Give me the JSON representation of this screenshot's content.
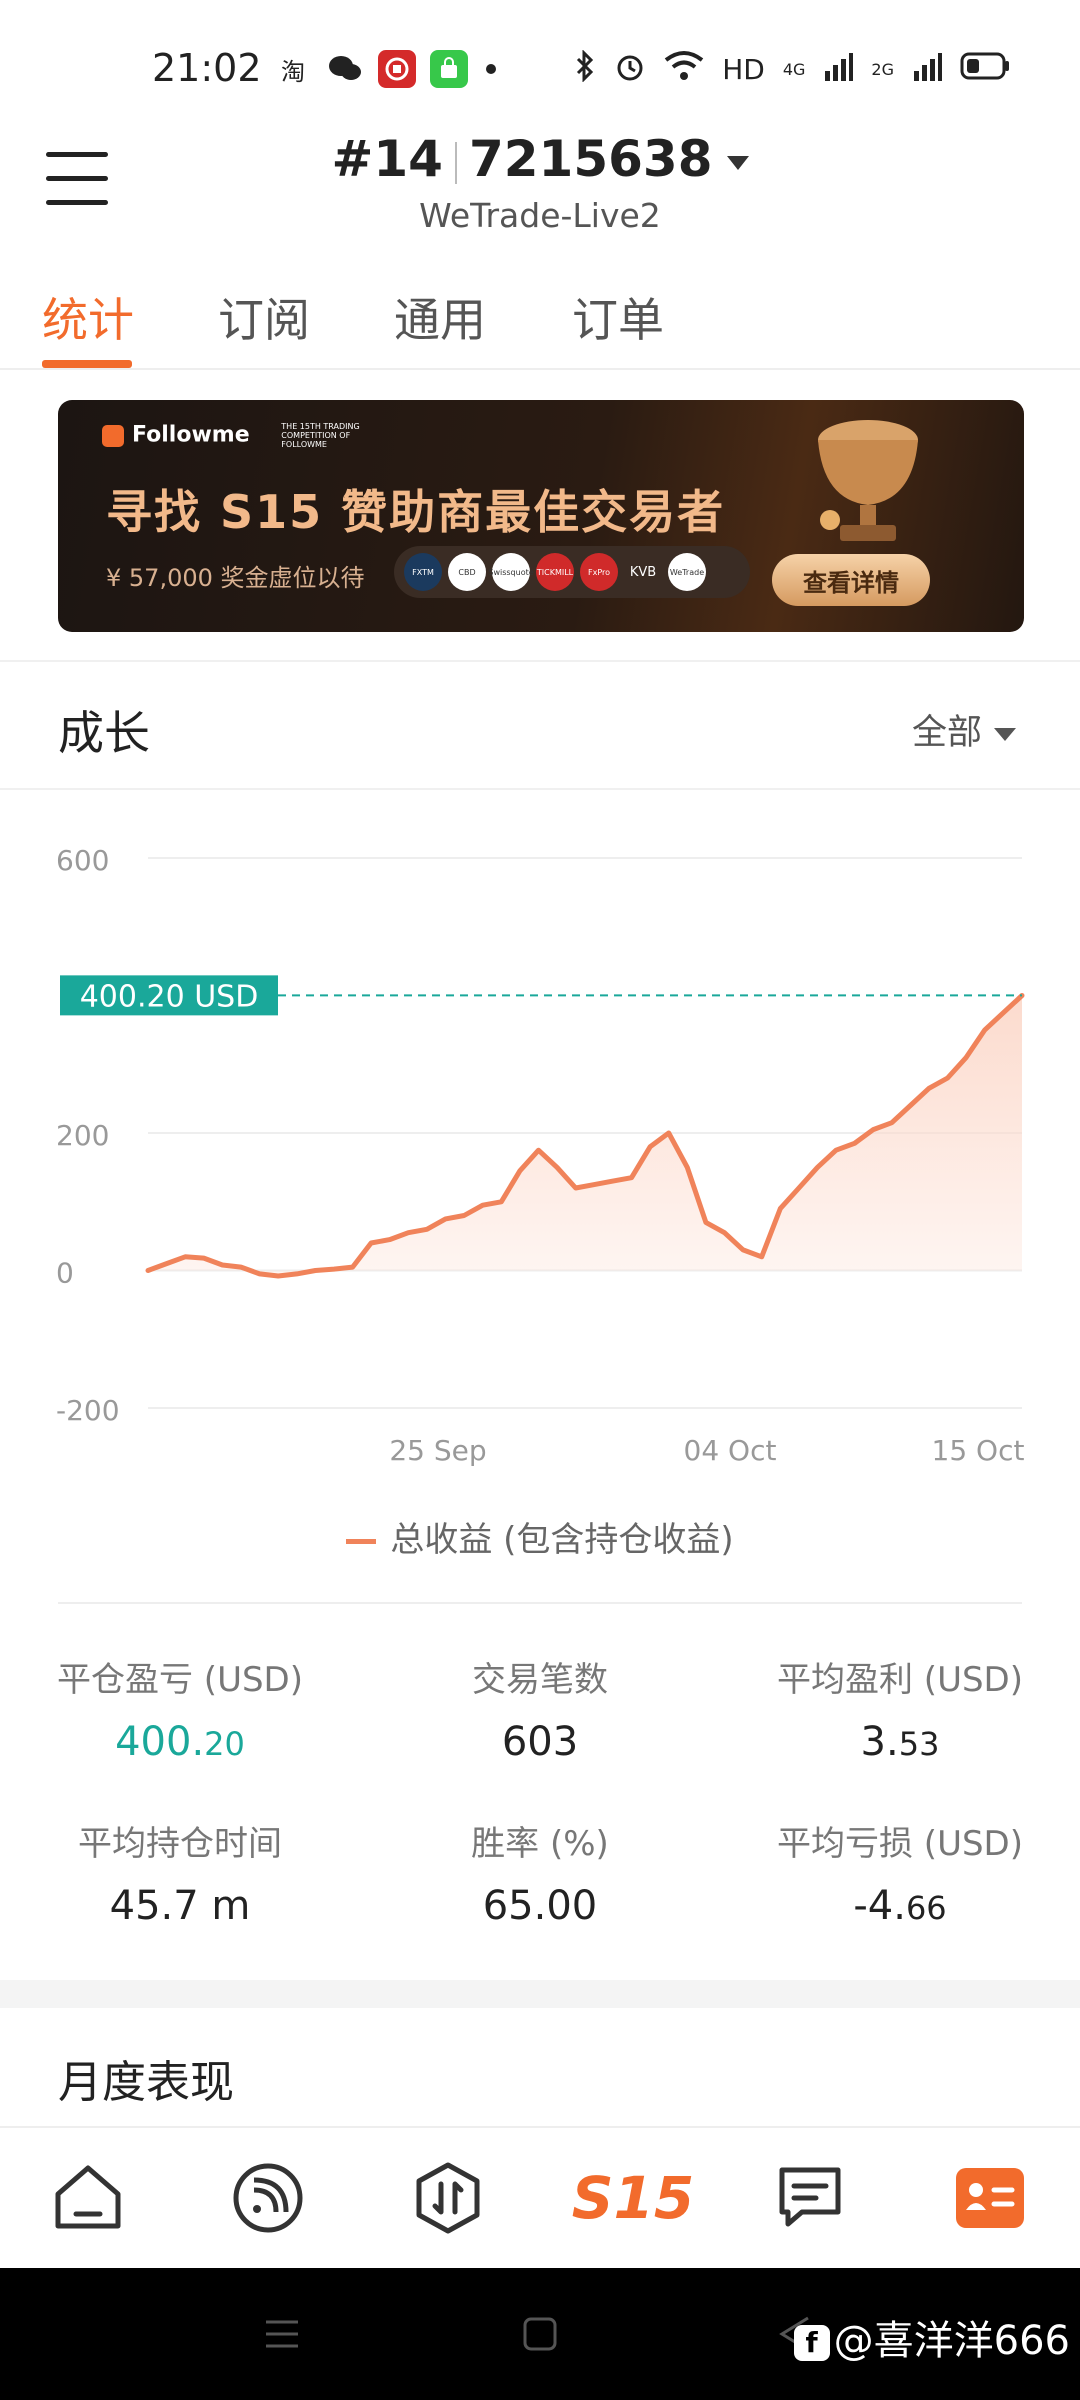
{
  "status_bar": {
    "time": "21:02",
    "app_icons": [
      "taobao-icon",
      "wechat-icon",
      "bank-icon",
      "shopping-bag-icon"
    ],
    "network_labels": [
      "HD",
      "4G",
      "2G"
    ]
  },
  "header": {
    "account_prefix": "#14",
    "account_number": "7215638",
    "server": "WeTrade-Live2"
  },
  "tabs": [
    {
      "label": "统计",
      "active": true
    },
    {
      "label": "订阅",
      "active": false
    },
    {
      "label": "通用",
      "active": false
    },
    {
      "label": "订单",
      "active": false
    }
  ],
  "banner": {
    "brand": "Followme",
    "brand_sub": "THE 15TH TRADING COMPETITION OF FOLLOWME",
    "title": "寻找 S15 赞助商最佳交易者",
    "subtitle": "¥ 57,000 奖金虚位以待",
    "sponsor_logos": [
      "FXTM",
      "CBD",
      "Swissquote",
      "TICKMILL",
      "FxPro",
      "KVB",
      "WeTrade"
    ],
    "button_label": "查看详情"
  },
  "growth": {
    "title": "成长",
    "range_label": "全部"
  },
  "chart_data": {
    "type": "area",
    "ylim": [
      -200,
      600
    ],
    "yticks": [
      "600",
      "200",
      "0",
      "-200"
    ],
    "xticks": [
      "25 Sep",
      "04 Oct",
      "15 Oct"
    ],
    "current_value_label": "400.20 USD",
    "current_value": 400.2,
    "line_color": "#f0835a",
    "fill_color": "#fcd9cb",
    "marker_color": "#1aa89a",
    "series": [
      {
        "name": "总收益 (包含持仓收益)",
        "values": [
          0,
          10,
          20,
          18,
          8,
          5,
          -5,
          -8,
          -5,
          0,
          2,
          5,
          40,
          45,
          55,
          60,
          75,
          80,
          95,
          100,
          145,
          175,
          150,
          120,
          125,
          130,
          135,
          180,
          200,
          150,
          70,
          55,
          30,
          20,
          90,
          120,
          150,
          175,
          185,
          205,
          215,
          240,
          265,
          280,
          310,
          350,
          375,
          400
        ]
      }
    ]
  },
  "stats": [
    {
      "label": "平仓盈亏 (USD)",
      "int": "400.",
      "dec": "20",
      "teal": true
    },
    {
      "label": "交易笔数",
      "int": "603",
      "dec": "",
      "teal": false
    },
    {
      "label": "平均盈利 (USD)",
      "int": "3.",
      "dec": "53",
      "teal": false
    },
    {
      "label": "平均持仓时间",
      "int": "45.7 m",
      "dec": "",
      "teal": false
    },
    {
      "label": "胜率 (%)",
      "int": "65.00",
      "dec": "",
      "teal": false
    },
    {
      "label": "平均亏损 (USD)",
      "int": "-4.",
      "dec": "66",
      "teal": false
    }
  ],
  "monthly": {
    "title": "月度表现"
  },
  "bottom_nav": {
    "items": [
      "home-icon",
      "subscribe-icon",
      "trade-icon",
      "s15-icon",
      "community-icon",
      "profile-icon"
    ],
    "s15_label": "S15",
    "accent": "#f26b2c"
  },
  "watermark": "@喜洋洋666"
}
